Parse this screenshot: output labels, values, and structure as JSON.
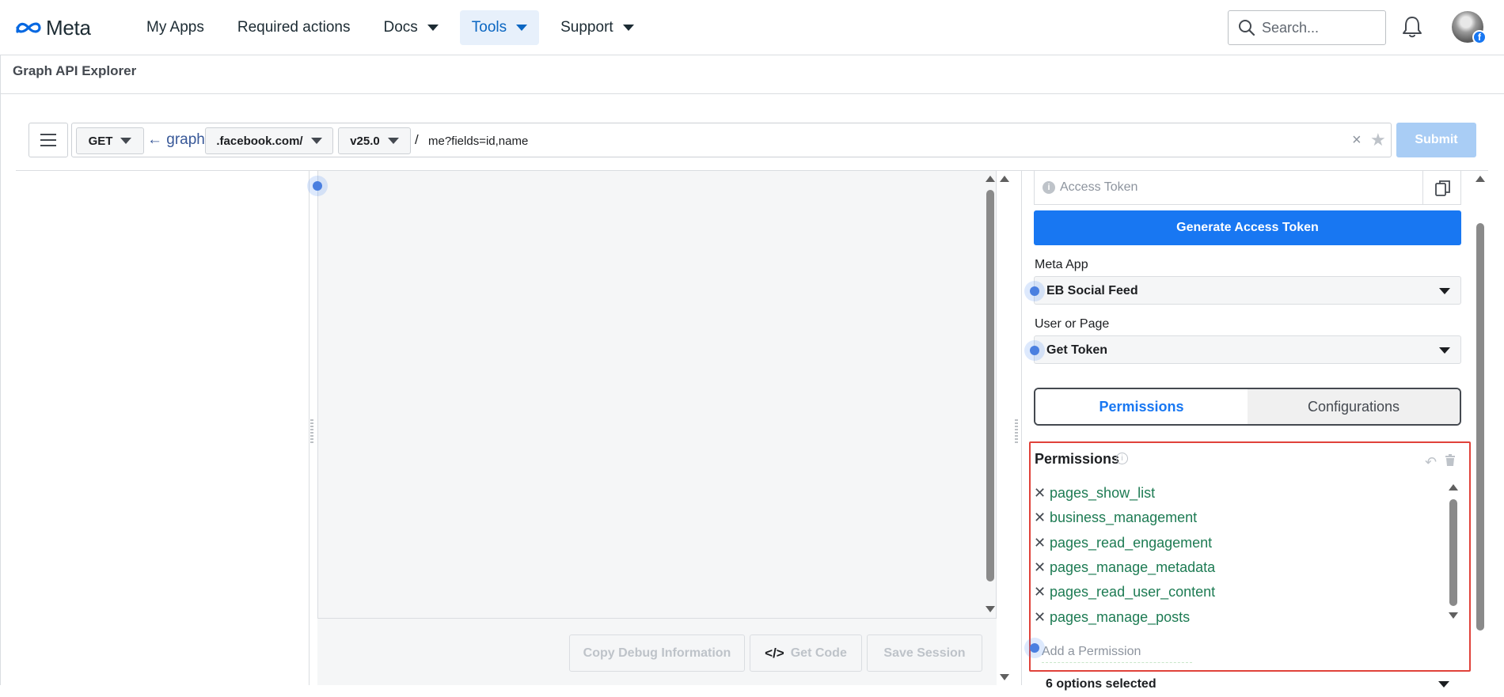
{
  "nav": {
    "logo_text": "Meta",
    "items": [
      {
        "label": "My Apps",
        "dropdown": false,
        "active": false
      },
      {
        "label": "Required actions",
        "dropdown": false,
        "active": false
      },
      {
        "label": "Docs",
        "dropdown": true,
        "active": false
      },
      {
        "label": "Tools",
        "dropdown": true,
        "active": true
      },
      {
        "label": "Support",
        "dropdown": true,
        "active": false
      }
    ],
    "search_placeholder": "Search...",
    "avatar_badge": "f"
  },
  "page_title": "Graph API Explorer",
  "query": {
    "method": "GET",
    "graph_prefix": "← graph.",
    "domain": ".facebook.com/",
    "version": "v25.0",
    "slash": "/",
    "path": "me?fields=id,name",
    "clear": "×",
    "star": "★",
    "submit_label": "Submit"
  },
  "footer_buttons": {
    "copy_debug": "Copy Debug Information",
    "get_code_glyph": "</>",
    "get_code": "Get Code",
    "save_session": "Save Session"
  },
  "right_panel": {
    "access_token_placeholder": "Access Token",
    "info_glyph": "i",
    "generate_label": "Generate Access Token",
    "meta_app_label": "Meta App",
    "meta_app_value": "EB Social Feed",
    "user_or_page_label": "User or Page",
    "user_or_page_value": "Get Token",
    "tabs": {
      "permissions": "Permissions",
      "configurations": "Configurations"
    },
    "permissions_title": "Permissions",
    "permissions": [
      "pages_show_list",
      "business_management",
      "pages_read_engagement",
      "pages_manage_metadata",
      "pages_read_user_content",
      "pages_manage_posts"
    ],
    "remove_glyph": "✕",
    "undo_glyph": "↶",
    "add_permission_placeholder": "Add a Permission",
    "options_selected": "6 options selected"
  },
  "colors": {
    "accent": "#1877f2",
    "permission_text": "#1d7b53",
    "highlight_border": "#e0423a",
    "submit_disabled": "#a9cdf5"
  }
}
